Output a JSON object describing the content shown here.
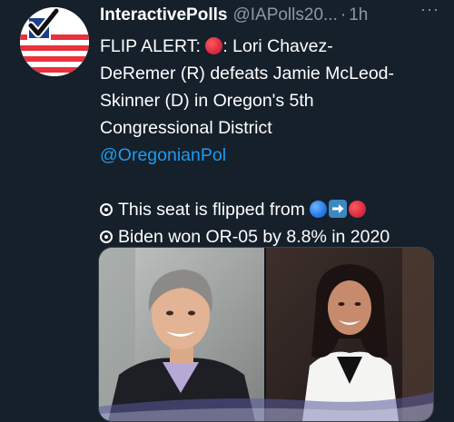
{
  "account": {
    "display_name": "InteractivePolls",
    "handle": "@IAPolls20...",
    "separator": "·",
    "time_ago": "1h",
    "more_label": "···"
  },
  "tweet": {
    "line1": "FLIP ALERT: ",
    "line1_after": ": Lori Chavez-",
    "line2": "DeRemer (R) defeats Jamie McLeod-",
    "line3": "Skinner (D) in Oregon's 5th",
    "line4": "Congressional District",
    "mention": "@OregonianPol",
    "bullet1": "This seat is flipped from ",
    "bullet2": "Biden won OR-05 by 8.8% in 2020"
  },
  "colors": {
    "background": "#15202b",
    "text": "#ffffff",
    "secondary_text": "#8b98a5",
    "link": "#1d9bf0",
    "red": "#dd2e44",
    "blue": "#2b7de9"
  },
  "icons": {
    "avatar": "ballot-flag-avatar",
    "more": "ellipsis-icon",
    "red": "red-circle-emoji",
    "blue": "blue-circle-emoji",
    "arrow": "right-arrow-emoji",
    "bullet": "radio-bullet-icon"
  }
}
